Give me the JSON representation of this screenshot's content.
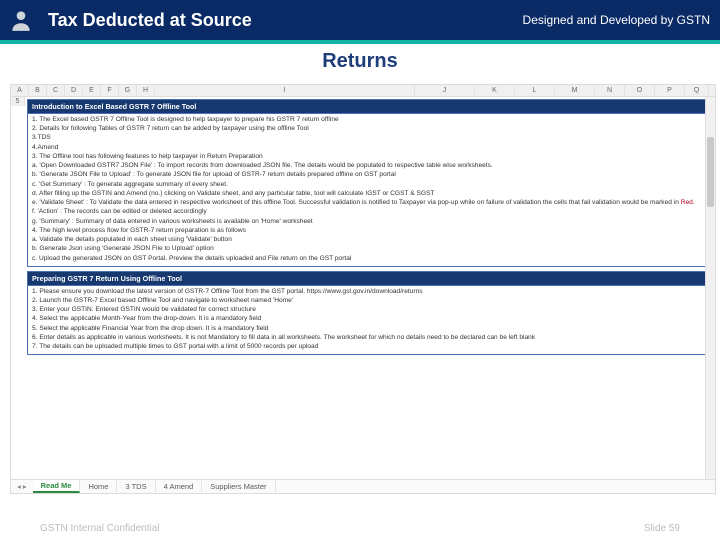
{
  "header": {
    "title": "Tax Deducted at Source",
    "credit": "Designed and Developed by GSTN",
    "subhead": "Returns"
  },
  "colLetters": [
    "A",
    "B",
    "C",
    "D",
    "E",
    "F",
    "G",
    "H",
    "I",
    "J",
    "K",
    "L",
    "M",
    "N",
    "O",
    "P",
    "Q"
  ],
  "rowStart": "5",
  "panel1": {
    "title": "Introduction to Excel Based GSTR 7 Offline Tool",
    "lines": [
      "1. The Excel based GSTR 7 Offline Tool is designed to help taxpayer to prepare his GSTR 7 return offline",
      "2. Details for following Tables of GSTR 7 return can be added by taxpayer using the offline Tool",
      "   3.TDS",
      "   4.Amend",
      "3. The Offline tool has following features to help taxpayer in Return Preparation",
      "   a. 'Open Downloaded GSTR7 JSON File' : To import records from downloaded JSON file. The details would be populated to respective table wise worksheets.",
      "   b. 'Generate JSON File to Upload' : To generate JSON file for upload of GSTR-7 return details prepared offline on GST portal",
      "   c. 'Get Summary' : To generate aggregate summary of every sheet.",
      "   d. After filling up the GSTIN and Amend (no.) clicking on Validate sheet, and any particular table, tool will calculate IGST or CGST & SGST",
      "   e. 'Validate Sheet' : To Validate the data entered in respective worksheet of this offline Tool. Successful validation is notified to Taxpayer via pop-up while on failure of validation the cells that fail validation would be marked in Red.",
      "   f. 'Action' : The records can be edited or deleted accordingly",
      "   g. 'Summary' : Summary of data entered in various worksheets is available on 'Home' worksheet",
      "4. The high level process flow for GSTR-7 return preparation is as follows",
      "   a. Validate the details populated in each sheet using 'Validate' button",
      "   b. Generate Json using 'Generate JSON File to Upload' option",
      "   c. Upload the generated JSON on GST Portal. Preview the details uploaded and File return on the GST portal"
    ]
  },
  "panel2": {
    "title": "Preparing GSTR 7 Return Using Offline Tool",
    "lines": [
      "1. Please ensure you download the latest version of GSTR-7 Offline Tool from the GST portal. https://www.gst.gov.in/download/returns",
      "2. Launch the GSTR-7 Excel based Offline Tool and navigate to worksheet named 'Home'",
      "3. Enter your GSTIN. Entered GSTIN would be validated for correct structure",
      "4. Select the applicable Month-Year from the drop-down. It is a mandatory field",
      "5. Select the applicable Financial Year from the drop down. It is a mandatory field",
      "6. Enter details as applicable in various worksheets. It is not Mandatory to fill data in all worksheets. The worksheet for which no details need to be declared can be left blank",
      "7. The details can be uploaded multiple times to GST portal with a limit of 5000 records per upload"
    ]
  },
  "tabs": {
    "items": [
      "Read Me",
      "Home",
      "3 TDS",
      "4 Amend",
      "Suppliers Master"
    ],
    "activeIndex": 0
  },
  "footer": {
    "left": "GSTN Internal Confidential",
    "right": "Slide 59"
  }
}
